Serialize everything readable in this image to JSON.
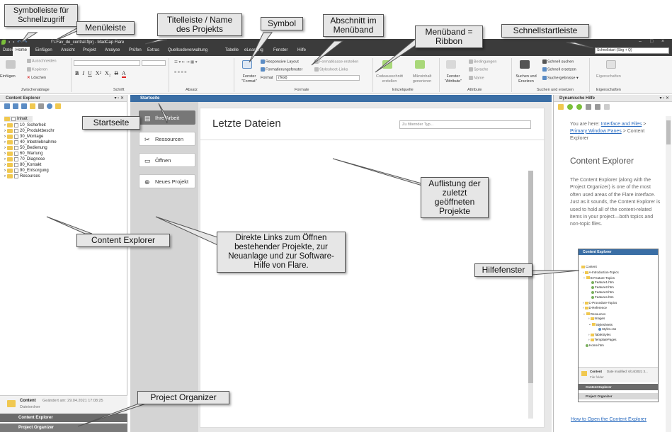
{
  "title_bar": {
    "app_name": "Pl-Fav_de_central.flprj - MadCap Flare",
    "minimize": "–",
    "maximize": "□",
    "close": "×"
  },
  "quick_launch": {
    "placeholder": "Schnellstart (Strg + Q)"
  },
  "menu": {
    "tabs": [
      "Datei",
      "Home",
      "Einfügen",
      "Ansicht",
      "Projekt",
      "Analyse",
      "Prüfen",
      "Extras",
      "Quellcodeverwaltung",
      "Tabelle",
      "eLearning",
      "Fenster",
      "Hilfe"
    ],
    "active": "Home"
  },
  "ribbon": {
    "clipboard": {
      "paste": "Einfügen",
      "cut": "Ausschneiden",
      "copy": "Kopieren",
      "delete": "Löschen",
      "label": "Zwischenablage"
    },
    "font": {
      "label": "Schrift",
      "bold": "B",
      "italic": "I",
      "underline": "U",
      "sup": "X²",
      "sub": "X₂",
      "strike": "B",
      "color": "A"
    },
    "paragraph": {
      "label": "Absatz"
    },
    "formats": {
      "label": "Formate",
      "window_format": "Fenster \"Format\"",
      "responsive": "Responsive Layout",
      "formatting_window": "Formatierungsfenster",
      "format_label": "Format",
      "format_value": "(Text)",
      "create_class": "Formatklasse erstellen",
      "stylesheet_links": "Stylesheet-Links"
    },
    "single_source": {
      "label": "Einzelquelle",
      "snippet": "Codeausschnitt erstellen",
      "microcontent": "Mikroinhalt generieren"
    },
    "attributes": {
      "label": "Attribute",
      "window_attr": "Fenster \"Attribute\"",
      "conditions": "Bedingungen",
      "language": "Sprache",
      "name": "Name"
    },
    "find_replace": {
      "label": "Suchen und ersetzen",
      "find_replace": "Suchen und Ersetzen",
      "quick_find": "Schnell suchen",
      "quick_replace": "Schnell ersetzen",
      "search_results": "Suchergebnisse"
    },
    "properties": {
      "label": "Eigenschaften",
      "btn": "Eigenschaften"
    }
  },
  "content_explorer": {
    "title": "Content Explorer",
    "items": [
      "Inhalt",
      "10_Sicherheit",
      "20_Produktbeschr",
      "30_Montage",
      "40_Inbetriebnahme",
      "50_Bedienung",
      "60_Wartung",
      "70_Diagnose",
      "80_Kontakt",
      "90_Entsorgung",
      "Resources"
    ],
    "status_name": "Content",
    "status_type": "Dateiordner",
    "status_changed": "Geändert am: 29.04.2021 17:08:25",
    "bar_content_explorer": "Content Explorer",
    "bar_project_organizer": "Project Organizer"
  },
  "start_page": {
    "tab_title": "Startseite",
    "nav": [
      "Ihre Arbeit",
      "Ressourcen",
      "Öffnen",
      "Neues Projekt"
    ],
    "recent_title": "Letzte Dateien",
    "filter_placeholder": "Zu filternder Typ..."
  },
  "dynamic_help": {
    "title": "Dynamische Hilfe",
    "breadcrumb_prefix": "You are here: ",
    "breadcrumb_link1": "Interface and Files",
    "breadcrumb_sep": " > ",
    "breadcrumb_link2": "Primary Window Panes",
    "breadcrumb_tail": " > Content Explorer",
    "heading": "Content Explorer",
    "paragraph": "The Content Explorer (along with the Project Organizer) is one of the most often used areas of the Flare interface. Just as it sounds, the Content Explorer is used to hold all of the content-related items in your project—both topics and non-topic files.",
    "bottom_link": "How to Open the Content Explorer",
    "inset": {
      "title": "Content Explorer",
      "items": [
        "Content",
        "A-Introduction-Topics",
        "B-Feature-Topics",
        "Feature1.htm",
        "Feature2.htm",
        "Feature3.htm",
        "Features.htm",
        "C-Procedure-Topics",
        "D-Reference",
        "Resources",
        "Images",
        "Stylesheets",
        "Styles.css",
        "TableStyles",
        "TemplatePages",
        "Home.htm"
      ],
      "status_name": "Content",
      "status_date": "Date modified: 6/14/2021 3...",
      "status_type": "File folder",
      "bar1": "Content Explorer",
      "bar2": "Project Organizer"
    }
  },
  "callouts": {
    "qat": "Symbolleiste für Schnellzugriff",
    "menubar": "Menüleiste",
    "titlebar": "Titelleiste / Name des Projekts",
    "symbol": "Symbol",
    "section": "Abschnitt im Menüband",
    "ribbon": "Menüband = Ribbon",
    "quicklaunch": "Schnellstartleiste",
    "startpage": "Startseite",
    "recent": "Auflistung der zuletzt geöffneten Projekte",
    "explorer": "Content Explorer",
    "links": "Direkte Links zum Öffnen bestehender Projekte, zur Neuanlage und zur Software-Hilfe von Flare.",
    "helpwindow": "Hilfefenster",
    "organizer": "Project Organizer"
  }
}
